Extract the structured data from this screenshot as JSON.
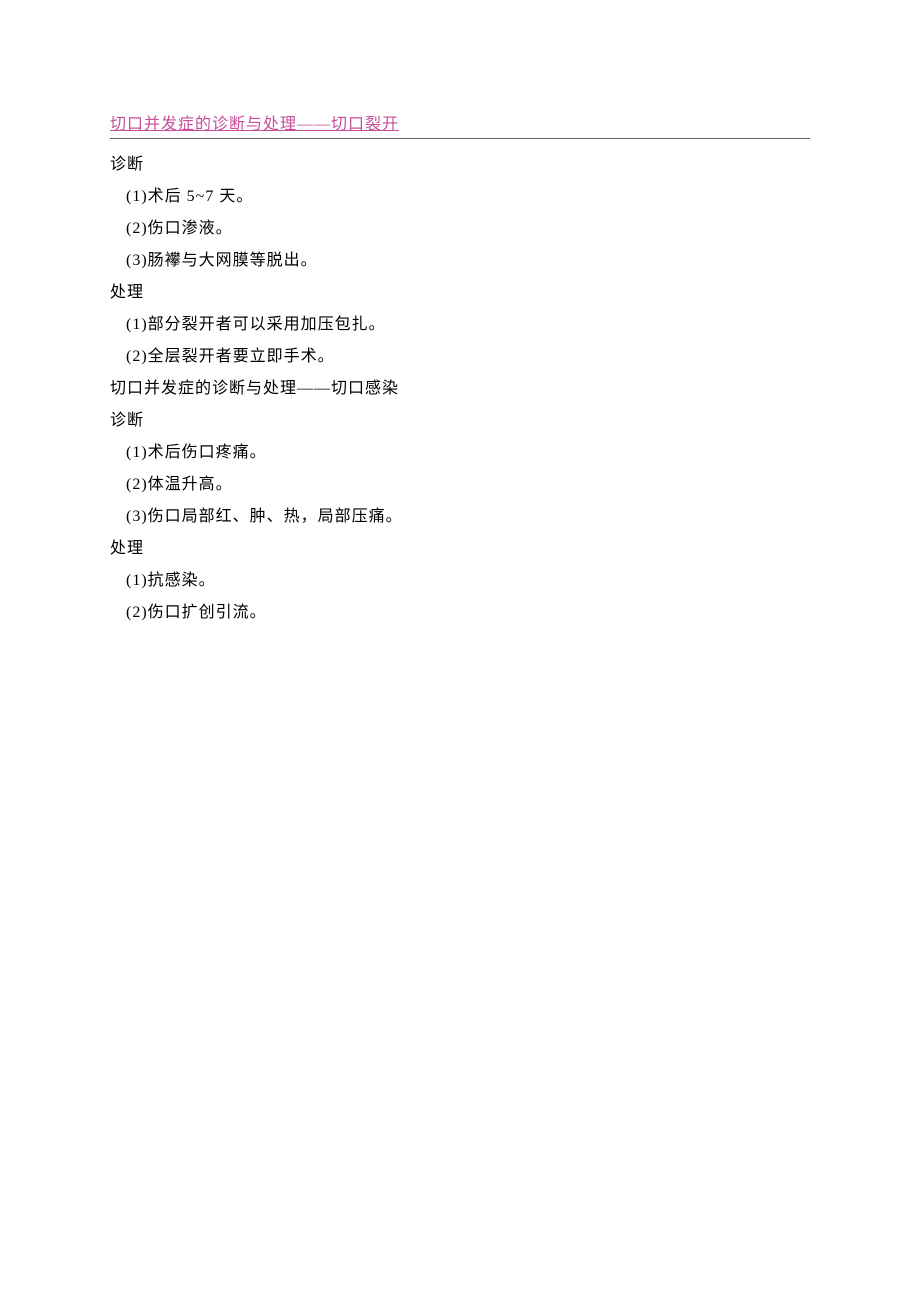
{
  "title": "切口并发症的诊断与处理——切口裂开",
  "section1": {
    "label": "诊断",
    "items": [
      "(1)术后 5~7 天。",
      "(2)伤口渗液。",
      "(3)肠襻与大网膜等脱出。"
    ]
  },
  "section2": {
    "label": "处理",
    "items": [
      "(1)部分裂开者可以采用加压包扎。",
      "(2)全层裂开者要立即手术。"
    ]
  },
  "subhead": "切口并发症的诊断与处理——切口感染",
  "section3": {
    "label": "诊断",
    "items": [
      "(1)术后伤口疼痛。",
      "(2)体温升高。",
      "(3)伤口局部红、肿、热，局部压痛。"
    ]
  },
  "section4": {
    "label": "处理",
    "items": [
      "(1)抗感染。",
      "(2)伤口扩创引流。"
    ]
  }
}
